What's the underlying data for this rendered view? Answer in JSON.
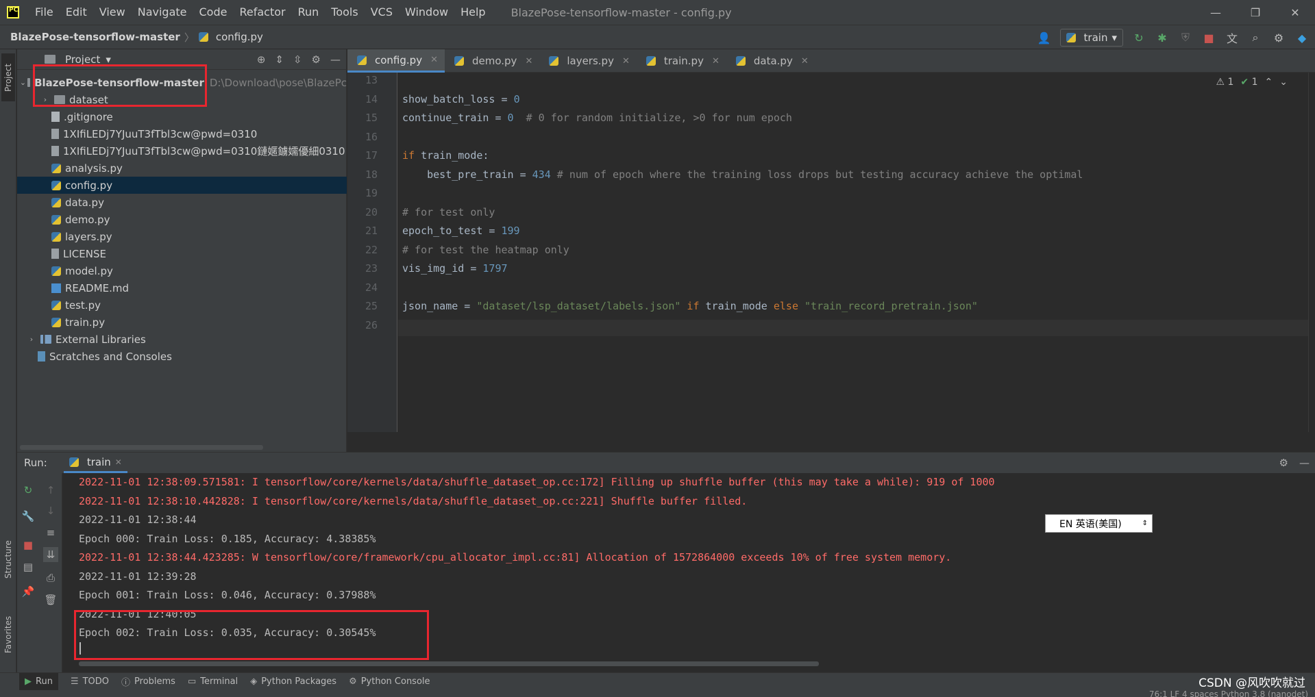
{
  "title_bar": {
    "menu": [
      "File",
      "Edit",
      "View",
      "Navigate",
      "Code",
      "Refactor",
      "Run",
      "Tools",
      "VCS",
      "Window",
      "Help"
    ],
    "window_title": "BlazePose-tensorflow-master - config.py",
    "controls": [
      "—",
      "❐",
      "✕"
    ]
  },
  "navbar": {
    "project": "BlazePose-tensorflow-master",
    "file": "config.py",
    "run_config": "train"
  },
  "left_stripe": {
    "project_tab": "Project",
    "structure_tab": "Structure",
    "favorites_tab": "Favorites"
  },
  "project_panel": {
    "title": "Project",
    "tree": [
      {
        "label": "BlazePose-tensorflow-master",
        "path": "D:\\Download\\pose\\BlazePc",
        "type": "folder",
        "arrow": "⌄"
      },
      {
        "label": "dataset",
        "type": "folder",
        "arrow": "›"
      },
      {
        "label": ".gitignore",
        "type": "git"
      },
      {
        "label": "1XIfiLEDj7YJuuT3fTbl3cw@pwd=0310",
        "type": "txt"
      },
      {
        "label": "1XIfiLEDj7YJuuT3fTbl3cw@pwd=0310鏈嫟鐪嬬優細0310",
        "type": "txt"
      },
      {
        "label": "analysis.py",
        "type": "py"
      },
      {
        "label": "config.py",
        "type": "py",
        "selected": true
      },
      {
        "label": "data.py",
        "type": "py"
      },
      {
        "label": "demo.py",
        "type": "py"
      },
      {
        "label": "layers.py",
        "type": "py"
      },
      {
        "label": "LICENSE",
        "type": "txt"
      },
      {
        "label": "model.py",
        "type": "py"
      },
      {
        "label": "README.md",
        "type": "md"
      },
      {
        "label": "test.py",
        "type": "py"
      },
      {
        "label": "train.py",
        "type": "py"
      },
      {
        "label": "External Libraries",
        "type": "lib",
        "arrow": "›"
      },
      {
        "label": "Scratches and Consoles",
        "type": "scratch"
      }
    ]
  },
  "editor_tabs": [
    "config.py",
    "demo.py",
    "layers.py",
    "train.py",
    "data.py"
  ],
  "editor": {
    "indicators": {
      "warnings": "1",
      "checks": "1"
    },
    "lines": [
      {
        "n": "13",
        "code": ""
      },
      {
        "n": "14",
        "code": "show_batch_loss = 0"
      },
      {
        "n": "15",
        "code": "continue_train = 0  # 0 for random initialize, >0 for num epoch"
      },
      {
        "n": "16",
        "code": ""
      },
      {
        "n": "17",
        "code": "if train_mode:"
      },
      {
        "n": "18",
        "code": "    best_pre_train = 434 # num of epoch where the training loss drops but testing accuracy achieve the optimal"
      },
      {
        "n": "19",
        "code": ""
      },
      {
        "n": "20",
        "code": "# for test only"
      },
      {
        "n": "21",
        "code": "epoch_to_test = 199"
      },
      {
        "n": "22",
        "code": "# for test the heatmap only"
      },
      {
        "n": "23",
        "code": "vis_img_id = 1797"
      },
      {
        "n": "24",
        "code": ""
      },
      {
        "n": "25",
        "code": "json_name = \"dataset/lsp_dataset/labels.json\" if train_mode else \"train_record_pretrain.json\""
      },
      {
        "n": "26",
        "code": ""
      }
    ]
  },
  "run_panel": {
    "label": "Run:",
    "tab": "train",
    "console": [
      {
        "text": "2022-11-01 12:38:09.571581: I tensorflow/core/kernels/data/shuffle_dataset_op.cc:172] Filling up shuffle buffer (this may take a while): 919 of 1000",
        "color": "red"
      },
      {
        "text": "2022-11-01 12:38:10.442828: I tensorflow/core/kernels/data/shuffle_dataset_op.cc:221] Shuffle buffer filled.",
        "color": "red"
      },
      {
        "text": "2022-11-01 12:38:44",
        "color": "white"
      },
      {
        "text": "Epoch 000: Train Loss: 0.185, Accuracy: 4.38385%",
        "color": "white"
      },
      {
        "text": "2022-11-01 12:38:44.423285: W tensorflow/core/framework/cpu_allocator_impl.cc:81] Allocation of 1572864000 exceeds 10% of free system memory.",
        "color": "red"
      },
      {
        "text": "2022-11-01 12:39:28",
        "color": "white"
      },
      {
        "text": "Epoch 001: Train Loss: 0.046, Accuracy: 0.37988%",
        "color": "white"
      },
      {
        "text": "2022-11-01 12:40:05",
        "color": "white"
      },
      {
        "text": "Epoch 002: Train Loss: 0.035, Accuracy: 0.30545%",
        "color": "white"
      }
    ]
  },
  "ime": "EN 英语(美国)",
  "bottom_tabs": [
    "Run",
    "TODO",
    "Problems",
    "Terminal",
    "Python Packages",
    "Python Console"
  ],
  "watermark": "CSDN @风吹吹就过",
  "status": "76:1   LF   4 spaces   Python 3.8 (nanodet)",
  "colors": {
    "accent": "#4a88c7",
    "highlight": "#e8262f",
    "error_text": "#ff6b68"
  }
}
